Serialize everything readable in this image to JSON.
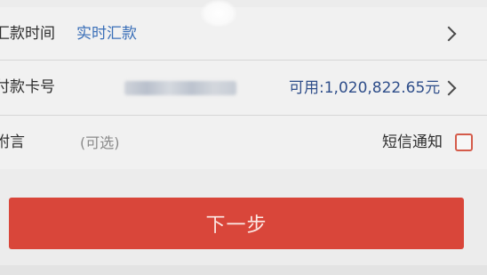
{
  "form": {
    "remit_time": {
      "label": "汇款时间",
      "value": "实时汇款",
      "icon": "chevron-right-icon"
    },
    "payment_card": {
      "label": "付款卡号",
      "available": "可用:1,020,822.65元",
      "icon": "chevron-right-icon"
    },
    "remark": {
      "label": "附言",
      "placeholder": "(可选)"
    },
    "sms_notify": {
      "label": "短信通知",
      "checked": false,
      "checkbox_color": "#d45b4a"
    }
  },
  "actions": {
    "next_label": "下一步",
    "next_color": "#d9463a"
  }
}
